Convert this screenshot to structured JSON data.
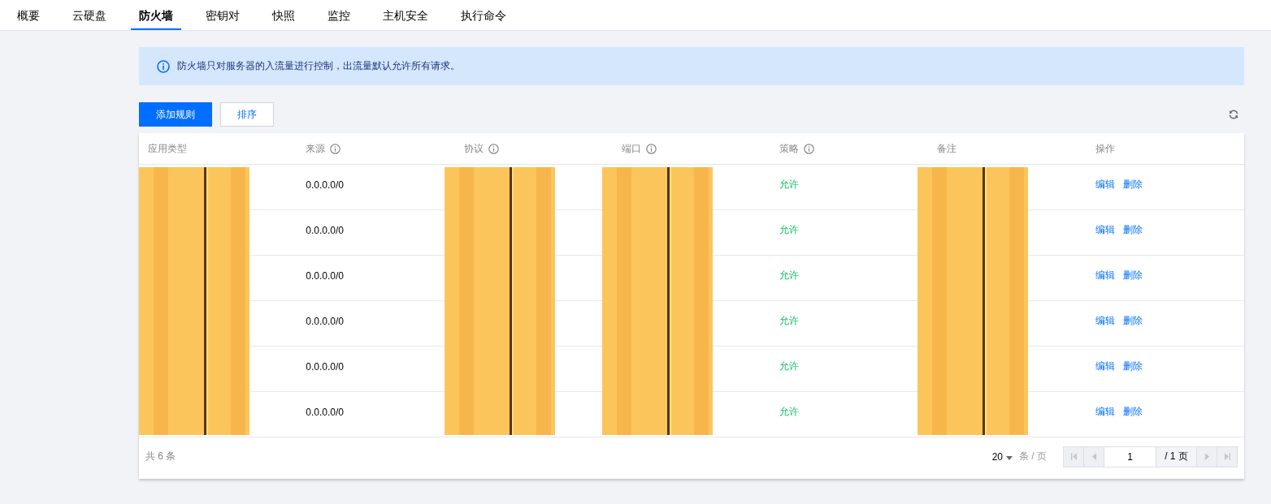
{
  "tabs": [
    {
      "label": "概要",
      "selected": false
    },
    {
      "label": "云硬盘",
      "selected": false
    },
    {
      "label": "防火墙",
      "selected": true
    },
    {
      "label": "密钥对",
      "selected": false
    },
    {
      "label": "快照",
      "selected": false
    },
    {
      "label": "监控",
      "selected": false
    },
    {
      "label": "主机安全",
      "selected": false
    },
    {
      "label": "执行命令",
      "selected": false
    }
  ],
  "notice": {
    "text": "防火墙只对服务器的入流量进行控制，出流量默认允许所有请求。"
  },
  "toolbar": {
    "buttons": [
      {
        "label": "添加规则",
        "kind": "primary"
      },
      {
        "label": "排序",
        "kind": "default"
      }
    ]
  },
  "table": {
    "columns": [
      {
        "label": "应用类型",
        "info_icon": false,
        "redacted": true
      },
      {
        "label": "来源",
        "info_icon": true,
        "redacted": false
      },
      {
        "label": "协议",
        "info_icon": true,
        "redacted": true
      },
      {
        "label": "端口",
        "info_icon": true,
        "redacted": true
      },
      {
        "label": "策略",
        "info_icon": true,
        "redacted": false
      },
      {
        "label": "备注",
        "info_icon": false,
        "redacted": true
      },
      {
        "label": "操作",
        "info_icon": false,
        "redacted": false
      }
    ],
    "rows": [
      {
        "source": "0.0.0.0/0",
        "policy": "允许",
        "actions": [
          "编辑",
          "删除"
        ]
      },
      {
        "source": "0.0.0.0/0",
        "policy": "允许",
        "actions": [
          "编辑",
          "删除"
        ]
      },
      {
        "source": "0.0.0.0/0",
        "policy": "允许",
        "actions": [
          "编辑",
          "删除"
        ]
      },
      {
        "source": "0.0.0.0/0",
        "policy": "允许",
        "actions": [
          "编辑",
          "删除"
        ]
      },
      {
        "source": "0.0.0.0/0",
        "policy": "允许",
        "actions": [
          "编辑",
          "删除"
        ]
      },
      {
        "source": "0.0.0.0/0",
        "policy": "允许",
        "actions": [
          "编辑",
          "删除"
        ]
      }
    ]
  },
  "footer": {
    "total": "共 6 条",
    "page_size": "20",
    "page_size_unit": "条 / 页",
    "pager": {
      "buttons": [
        {
          "kind": "first",
          "disabled": true
        },
        {
          "kind": "prev",
          "disabled": true
        },
        {
          "kind": "next",
          "disabled": true
        },
        {
          "kind": "last",
          "disabled": true
        }
      ],
      "page_input": "1",
      "page_total": "/ 1 页"
    }
  }
}
